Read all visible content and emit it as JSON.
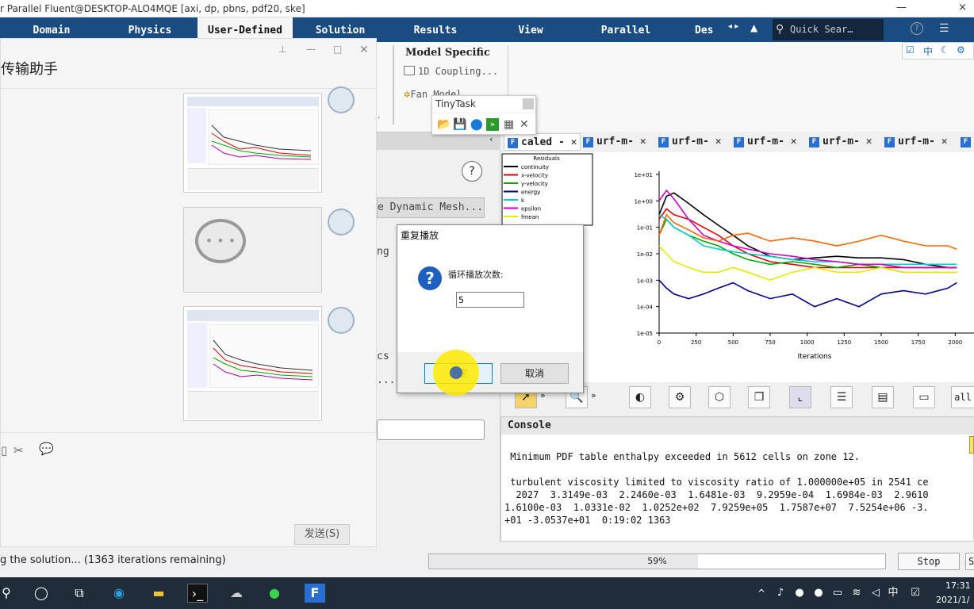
{
  "window": {
    "title": "r Parallel Fluent@DESKTOP-ALO4MQE  [axi, dp, pbns, pdf20, ske]",
    "min": "—",
    "close": "×"
  },
  "ribbon": {
    "tabs": [
      {
        "label": "Domain"
      },
      {
        "label": "Physics"
      },
      {
        "label": "User-Defined"
      },
      {
        "label": "Solution"
      },
      {
        "label": "Results"
      },
      {
        "label": "View"
      },
      {
        "label": "Parallel"
      },
      {
        "label": "Des"
      }
    ],
    "search_placeholder": "Quick Sear…",
    "model_specific": "Model Specific",
    "coupling": "1D Coupling...",
    "fan_model": "Fan Model",
    "dynamic_mesh": "e Dynamic Mesh...",
    "partial_ng": "ng I",
    "partial_cs": "cs",
    "partial_dots": "..."
  },
  "chat": {
    "title": "传输助手",
    "send_label": "发送(S)"
  },
  "tinytask": {
    "title": "TinyTask"
  },
  "graph": {
    "tabs": [
      {
        "label": "caled -"
      },
      {
        "label": "urf-m-"
      },
      {
        "label": "urf-m-"
      },
      {
        "label": "urf-m-"
      },
      {
        "label": "urf-m-"
      },
      {
        "label": "urf-m-"
      }
    ],
    "legend_title": "Residuals"
  },
  "chart_data": {
    "type": "line",
    "title": "",
    "xlabel": "Iterations",
    "ylabel": "",
    "log_y": true,
    "xlim": [
      0,
      2100
    ],
    "ylim": [
      1e-05,
      10
    ],
    "xticks": [
      "0",
      "250",
      "500",
      "750",
      "1000",
      "1250",
      "1500",
      "1750",
      "2000"
    ],
    "yticks": [
      "1e-05",
      "1e-04",
      "1e-03",
      "1e-02",
      "1e-01",
      "1e+00",
      "1e+01"
    ],
    "legend_position": "top-left",
    "x": [
      0,
      50,
      100,
      200,
      300,
      400,
      500,
      600,
      750,
      900,
      1050,
      1200,
      1350,
      1500,
      1650,
      1800,
      1950,
      2010
    ],
    "series": [
      {
        "name": "continuity",
        "color": "#000000",
        "values": [
          0.3,
          1.5,
          2.0,
          0.8,
          0.3,
          0.12,
          0.05,
          0.02,
          0.008,
          0.006,
          0.007,
          0.008,
          0.007,
          0.007,
          0.006,
          0.004,
          0.003,
          0.003
        ]
      },
      {
        "name": "x-velocity",
        "color": "#e00000",
        "values": [
          0.2,
          0.5,
          0.3,
          0.2,
          0.1,
          0.05,
          0.02,
          0.01,
          0.005,
          0.004,
          0.003,
          0.003,
          0.003,
          0.003,
          0.003,
          0.003,
          0.003,
          0.003
        ]
      },
      {
        "name": "y-velocity",
        "color": "#00aa00",
        "values": [
          0.05,
          0.2,
          0.1,
          0.05,
          0.03,
          0.02,
          0.01,
          0.006,
          0.004,
          0.005,
          0.004,
          0.003,
          0.004,
          0.003,
          0.002,
          0.002,
          0.002,
          0.002
        ]
      },
      {
        "name": "energy",
        "color": "#000088",
        "values": [
          0.001,
          0.0005,
          0.0003,
          0.0002,
          0.0003,
          0.0005,
          0.0008,
          0.0004,
          0.0002,
          0.0003,
          0.0001,
          0.0002,
          0.0001,
          0.0003,
          0.0004,
          0.0003,
          0.0005,
          0.0008
        ]
      },
      {
        "name": "k",
        "color": "#00cccc",
        "values": [
          0.3,
          0.2,
          0.1,
          0.05,
          0.02,
          0.015,
          0.012,
          0.01,
          0.008,
          0.006,
          0.005,
          0.005,
          0.004,
          0.004,
          0.004,
          0.004,
          0.004,
          0.004
        ]
      },
      {
        "name": "epsilon",
        "color": "#cc00cc",
        "values": [
          1.0,
          2.5,
          1.2,
          0.2,
          0.05,
          0.03,
          0.02,
          0.015,
          0.01,
          0.008,
          0.006,
          0.005,
          0.004,
          0.004,
          0.003,
          0.003,
          0.003,
          0.003
        ]
      },
      {
        "name": "fmean",
        "color": "#e8e800",
        "values": [
          0.02,
          0.01,
          0.005,
          0.003,
          0.002,
          0.002,
          0.003,
          0.002,
          0.001,
          0.002,
          0.003,
          0.002,
          0.002,
          0.003,
          0.002,
          0.002,
          0.002,
          0.002
        ]
      },
      {
        "name": "",
        "color": "#ff6600",
        "values": [
          0.05,
          0.3,
          0.15,
          0.08,
          0.04,
          0.03,
          0.05,
          0.06,
          0.03,
          0.04,
          0.03,
          0.02,
          0.03,
          0.05,
          0.03,
          0.02,
          0.02,
          0.015
        ]
      }
    ]
  },
  "console": {
    "title": "Console",
    "lines": [
      " Minimum PDF table enthalpy exceeded in 5612 cells on zone 12.",
      "",
      " turbulent viscosity limited to viscosity ratio of 1.000000e+05 in 2541 ce",
      "  2027  3.3149e-03  2.2460e-03  1.6481e-03  9.2959e-04  1.6984e-03  2.9610",
      "1.6100e-03  1.0331e-02  1.0252e+02  7.9259e+05  1.7587e+07  7.5254e+06 -3.",
      "+01 -3.0537e+01  0:19:02 1363"
    ]
  },
  "status": {
    "text": "g the solution... (1363 iterations remaining)",
    "progress_text": "59%",
    "progress": 0.59,
    "stop_label": "Stop",
    "s_label": "S"
  },
  "dialog": {
    "title": "重复播放",
    "label": "循环播放次数:",
    "value": "5",
    "ok_label": "确定",
    "cancel_label": "取消"
  },
  "toolbar": {
    "all_label": "all"
  },
  "taskbar": {
    "time": "17:31",
    "date": "2021/1/",
    "ime": "中"
  }
}
